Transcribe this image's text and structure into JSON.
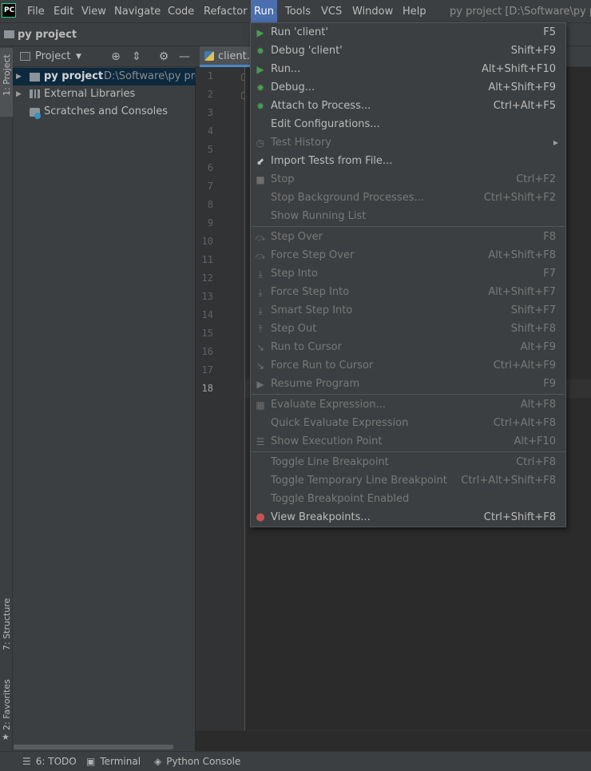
{
  "menubar": {
    "logo": "PC",
    "items": [
      "File",
      "Edit",
      "View",
      "Navigate",
      "Code",
      "Refactor",
      "Run",
      "Tools",
      "VCS",
      "Window",
      "Help"
    ],
    "window_title": "py project [D:\\Software\\py p"
  },
  "navbar": {
    "title": "py project"
  },
  "left_strip": {
    "project_tab": "1: Project",
    "structure_tab": "7: Structure",
    "favorites_tab": "2: Favorites"
  },
  "project_panel": {
    "header_label": "Project",
    "tree": [
      {
        "name": "py project",
        "path": "D:\\Software\\py pro"
      },
      {
        "name": "External Libraries"
      },
      {
        "name": "Scratches and Consoles"
      }
    ]
  },
  "editor": {
    "tab_label": "client.py",
    "line_numbers": [
      "1",
      "2",
      "3",
      "4",
      "5",
      "6",
      "7",
      "8",
      "9",
      "10",
      "11",
      "12",
      "13",
      "14",
      "15",
      "16",
      "17",
      "18"
    ],
    "current_line": "18"
  },
  "bottom_bar": {
    "todo": "6: TODO",
    "terminal": "Terminal",
    "python_console": "Python Console"
  },
  "run_menu": {
    "items": [
      {
        "label": "Run 'client'",
        "shortcut": "F5",
        "icon": "run-icon",
        "enabled": true
      },
      {
        "label": "Debug 'client'",
        "shortcut": "Shift+F9",
        "icon": "debug-icon",
        "enabled": true
      },
      {
        "label": "Run...",
        "shortcut": "Alt+Shift+F10",
        "icon": "run-icon",
        "enabled": true
      },
      {
        "label": "Debug...",
        "shortcut": "Alt+Shift+F9",
        "icon": "debug-icon",
        "enabled": true
      },
      {
        "label": "Attach to Process...",
        "shortcut": "Ctrl+Alt+F5",
        "icon": "attach-icon",
        "enabled": true
      },
      {
        "label": "Edit Configurations...",
        "shortcut": "",
        "icon": "",
        "enabled": true
      },
      {
        "label": "Test History",
        "shortcut": "",
        "icon": "history-icon",
        "enabled": false,
        "submenu": true
      },
      {
        "label": "Import Tests from File...",
        "shortcut": "",
        "icon": "import-icon",
        "enabled": true
      },
      {
        "label": "Stop",
        "shortcut": "Ctrl+F2",
        "icon": "stop-icon",
        "enabled": false
      },
      {
        "label": "Stop Background Processes...",
        "shortcut": "Ctrl+Shift+F2",
        "icon": "",
        "enabled": false
      },
      {
        "label": "Show Running List",
        "shortcut": "",
        "icon": "",
        "enabled": false
      },
      {
        "label": "Step Over",
        "shortcut": "F8",
        "icon": "step-over-icon",
        "enabled": false
      },
      {
        "label": "Force Step Over",
        "shortcut": "Alt+Shift+F8",
        "icon": "force-step-over-icon",
        "enabled": false
      },
      {
        "label": "Step Into",
        "shortcut": "F7",
        "icon": "step-into-icon",
        "enabled": false
      },
      {
        "label": "Force Step Into",
        "shortcut": "Alt+Shift+F7",
        "icon": "force-step-into-icon",
        "enabled": false
      },
      {
        "label": "Smart Step Into",
        "shortcut": "Shift+F7",
        "icon": "smart-step-into-icon",
        "enabled": false
      },
      {
        "label": "Step Out",
        "shortcut": "Shift+F8",
        "icon": "step-out-icon",
        "enabled": false
      },
      {
        "label": "Run to Cursor",
        "shortcut": "Alt+F9",
        "icon": "run-to-cursor-icon",
        "enabled": false
      },
      {
        "label": "Force Run to Cursor",
        "shortcut": "Ctrl+Alt+F9",
        "icon": "force-run-to-cursor-icon",
        "enabled": false
      },
      {
        "label": "Resume Program",
        "shortcut": "F9",
        "icon": "resume-icon",
        "enabled": false
      },
      {
        "label": "Evaluate Expression...",
        "shortcut": "Alt+F8",
        "icon": "evaluate-icon",
        "enabled": false
      },
      {
        "label": "Quick Evaluate Expression",
        "shortcut": "Ctrl+Alt+F8",
        "icon": "",
        "enabled": false
      },
      {
        "label": "Show Execution Point",
        "shortcut": "Alt+F10",
        "icon": "execution-point-icon",
        "enabled": false
      },
      {
        "label": "Toggle Line Breakpoint",
        "shortcut": "Ctrl+F8",
        "icon": "",
        "enabled": false
      },
      {
        "label": "Toggle Temporary Line Breakpoint",
        "shortcut": "Ctrl+Alt+Shift+F8",
        "icon": "",
        "enabled": false
      },
      {
        "label": "Toggle Breakpoint Enabled",
        "shortcut": "",
        "icon": "",
        "enabled": false
      },
      {
        "label": "View Breakpoints...",
        "shortcut": "Ctrl+Shift+F8",
        "icon": "breakpoints-icon",
        "enabled": true
      }
    ]
  },
  "colors": {
    "accent": "#4b6eaf",
    "background": "#2b2b2b",
    "panel": "#3c3f41",
    "run_green": "#499c54",
    "breakpoint_red": "#c75450"
  }
}
